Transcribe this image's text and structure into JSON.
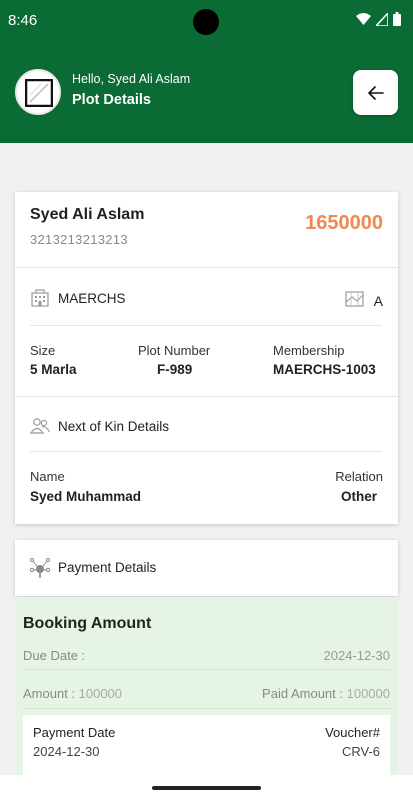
{
  "status": {
    "time": "8:46"
  },
  "header": {
    "greeting": "Hello, Syed Ali Aslam",
    "title": "Plot Details"
  },
  "owner": {
    "name": "Syed Ali Aslam",
    "cnic": "3213213213213",
    "amount": "1650000"
  },
  "plot": {
    "society": "MAERCHS",
    "block": "A",
    "size_label": "Size",
    "size_value": "5 Marla",
    "plot_number_label": "Plot Number",
    "plot_number_value": "F-989",
    "membership_label": "Membership",
    "membership_value": "MAERCHS-1003"
  },
  "kin": {
    "title": "Next of Kin Details",
    "name_label": "Name",
    "name_value": "Syed Muhammad",
    "relation_label": "Relation",
    "relation_value": "Other"
  },
  "payment": {
    "title": "Payment Details",
    "booking": {
      "title": "Booking Amount",
      "due_date_label": "Due Date :",
      "due_date_value": "2024-12-30",
      "amount_label": "Amount : ",
      "amount_value": "100000",
      "paid_label": "Paid Amount : ",
      "paid_value": "100000",
      "payment_date_label": "Payment Date",
      "payment_date_value": "2024-12-30",
      "voucher_label": "Voucher#",
      "voucher_value": "CRV-6"
    }
  },
  "colors": {
    "primary": "#0b6b34",
    "amount": "#f0884f",
    "booking_bg": "#e6f4e6"
  },
  "icons": [
    "wifi-icon",
    "signal-icon",
    "battery-icon",
    "back-arrow-icon",
    "building-icon",
    "map-icon",
    "people-icon",
    "payment-icon"
  ]
}
